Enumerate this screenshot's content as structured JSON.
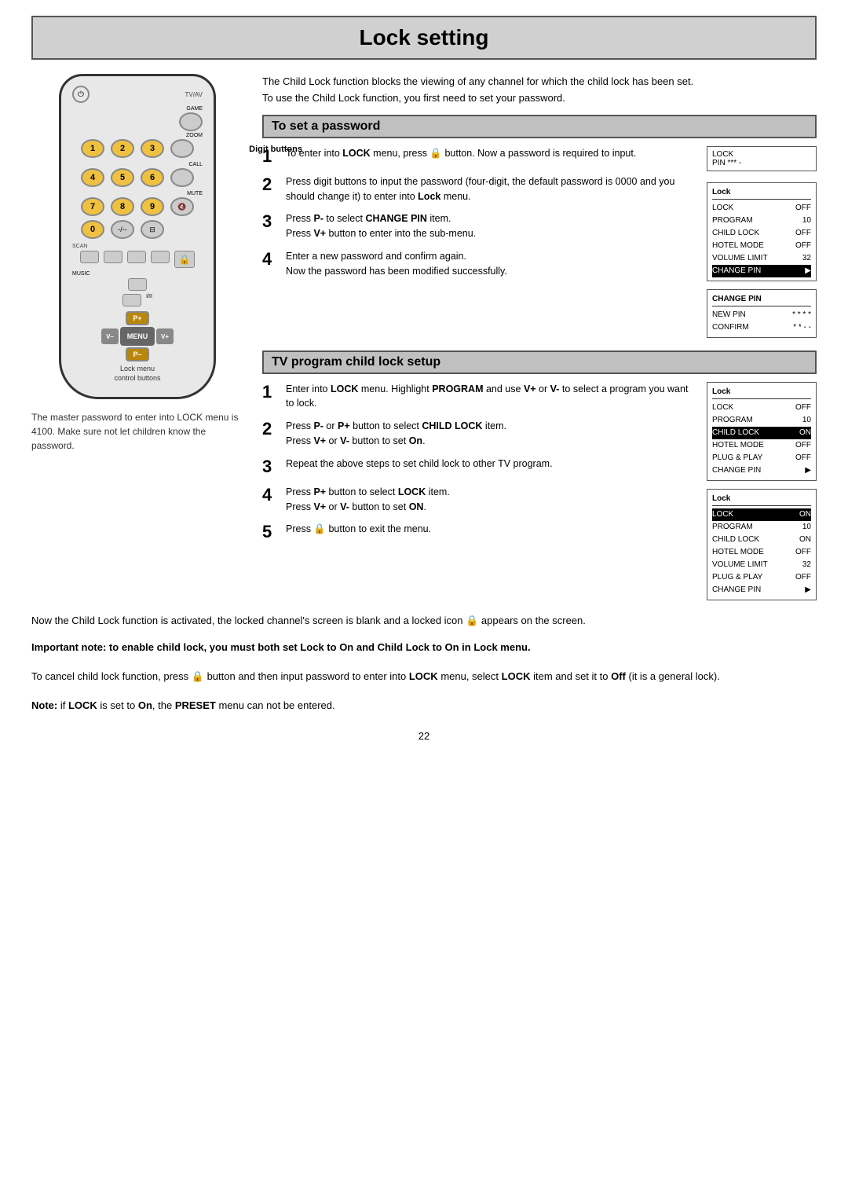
{
  "page": {
    "title": "Lock setting",
    "page_number": "22"
  },
  "intro": {
    "line1": "The Child Lock function blocks the viewing of any channel for which the child lock has been set.",
    "line2": "To use the Child Lock function, you first need to set your password."
  },
  "section1": {
    "header": "To set a password",
    "steps": [
      {
        "num": "1",
        "text": "To enter into LOCK menu, press 🔒 button. Now a password is required to input."
      },
      {
        "num": "2",
        "text": "Press digit buttons to input the password (four-digit, the default password is 0000 and you should change it) to enter into Lock menu."
      },
      {
        "num": "3",
        "text": "Press P- to select CHANGE PIN item.\nPress V+ button to enter into the sub-menu."
      },
      {
        "num": "4",
        "text": "Enter a new password and confirm again.\nNow the password has been modified successfully."
      }
    ]
  },
  "section2": {
    "header": "TV program child lock setup",
    "steps": [
      {
        "num": "1",
        "text": "Enter into LOCK menu. Highlight PROGRAM and use V+ or V- to select a program you want to lock."
      },
      {
        "num": "2",
        "text": "Press P- or P+ button to select CHILD LOCK item.\nPress V+ or V- button to set On."
      },
      {
        "num": "3",
        "text": "Repeat the above steps to set child lock to other TV program."
      },
      {
        "num": "4",
        "text": "Press P+ button to select LOCK item.\nPress V+ or V- button to set ON."
      },
      {
        "num": "5",
        "text": "Press 🔒 button to exit the menu."
      }
    ]
  },
  "screens": {
    "pin_display": {
      "line1": "LOCK",
      "line2": "PIN *** -"
    },
    "lock_screen1": {
      "title": "Lock",
      "rows": [
        {
          "label": "LOCK",
          "value": "OFF",
          "highlight": false
        },
        {
          "label": "PROGRAM",
          "value": "10",
          "highlight": false
        },
        {
          "label": "CHILD LOCK",
          "value": "OFF",
          "highlight": false
        },
        {
          "label": "HOTEL MODE",
          "value": "OFF",
          "highlight": false
        },
        {
          "label": "VOLUME LIMIT",
          "value": "32",
          "highlight": false
        },
        {
          "label": "CHANGE PIN",
          "value": "►",
          "highlight": true
        }
      ]
    },
    "change_pin_screen": {
      "title": "CHANGE PIN",
      "rows": [
        {
          "label": "NEW PIN",
          "value": "* * * *"
        },
        {
          "label": "CONFIRM",
          "value": "* * - -"
        }
      ]
    },
    "lock_screen2": {
      "title": "Lock",
      "rows": [
        {
          "label": "LOCK",
          "value": "OFF",
          "highlight": false
        },
        {
          "label": "PROGRAM",
          "value": "10",
          "highlight": false
        },
        {
          "label": "CHILD LOCK",
          "value": "ON",
          "highlight": true
        },
        {
          "label": "HOTEL MODE",
          "value": "OFF",
          "highlight": false
        },
        {
          "label": "PLUG & PLAY",
          "value": "OFF",
          "highlight": false
        },
        {
          "label": "CHANGE PIN",
          "value": "►",
          "highlight": false
        }
      ]
    },
    "lock_screen3": {
      "title": "Lock",
      "rows": [
        {
          "label": "LOCK",
          "value": "ON",
          "highlight": true
        },
        {
          "label": "PROGRAM",
          "value": "10",
          "highlight": false
        },
        {
          "label": "CHILD LOCK",
          "value": "ON",
          "highlight": false
        },
        {
          "label": "HOTEL MODE",
          "value": "OFF",
          "highlight": false
        },
        {
          "label": "VOLUME LIMIT",
          "value": "32",
          "highlight": false
        },
        {
          "label": "PLUG & PLAY",
          "value": "OFF",
          "highlight": false
        },
        {
          "label": "CHANGE PIN",
          "value": "►",
          "highlight": false
        }
      ]
    }
  },
  "remote": {
    "digit_label": "Digit buttons",
    "lock_menu_label": "Lock menu\ncontrol buttons",
    "buttons": {
      "num1": "1",
      "num2": "2",
      "num3": "3",
      "num4": "4",
      "num5": "5",
      "num6": "6",
      "num7": "7",
      "num8": "8",
      "num9": "9",
      "num0": "0",
      "p_plus": "P+",
      "p_minus": "P–",
      "v_minus": "V–",
      "v_plus": "V+",
      "menu": "MENU"
    },
    "labels": {
      "tv_av": "TV/AV",
      "game": "GAME",
      "zoom": "ZOOM",
      "call": "CALL",
      "mute": "MUTE",
      "scan": "SCAN",
      "music": "MUSIC",
      "i_ii": "I/II"
    }
  },
  "caption": {
    "remote_caption": "The master password to enter into LOCK menu is 4100. Make sure not let children know the password."
  },
  "bottom_notes": {
    "note1": "Now the Child Lock function is activated, the locked channel's screen is blank and a locked icon 🔒 appears on the screen.",
    "important": "Important note: to enable child lock, you must both set Lock to On and Child Lock to On in Lock menu.",
    "cancel_note": "To cancel child lock function, press 🔒 button and then input password to enter into LOCK menu, select LOCK item and set it to Off (it is a general lock).",
    "note_preset": "Note: if LOCK is set to On, the PRESET menu can not be entered."
  }
}
